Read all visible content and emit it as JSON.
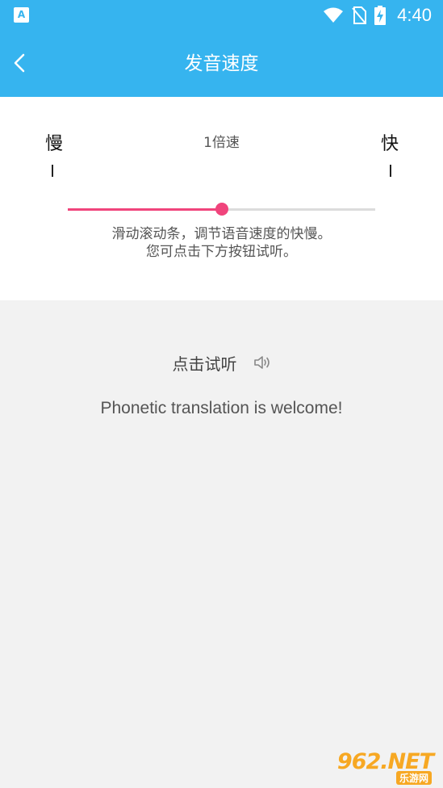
{
  "status_bar": {
    "app_icon": "A",
    "time": "4:40",
    "icons": [
      "wifi-icon",
      "no-sim-icon",
      "battery-charging-icon"
    ]
  },
  "app_bar": {
    "title": "发音速度",
    "back_icon": "chevron-left-icon"
  },
  "speed_control": {
    "slow_label": "慢",
    "fast_label": "快",
    "current_value": "1倍速",
    "slider_position_fraction": 0.5,
    "slider_color": "#f0447c",
    "hint_line1": "滑动滚动条，调节语音速度的快慢。",
    "hint_line2": "您可点击下方按钮试听。"
  },
  "preview": {
    "try_label": "点击试听",
    "speaker_icon": "speaker-icon",
    "sample_text": "Phonetic translation is welcome!"
  },
  "watermark": {
    "main": "962.NET",
    "sub": "乐游网"
  },
  "colors": {
    "primary": "#36b4ef",
    "accent": "#f0447c",
    "background": "#f2f2f2"
  }
}
